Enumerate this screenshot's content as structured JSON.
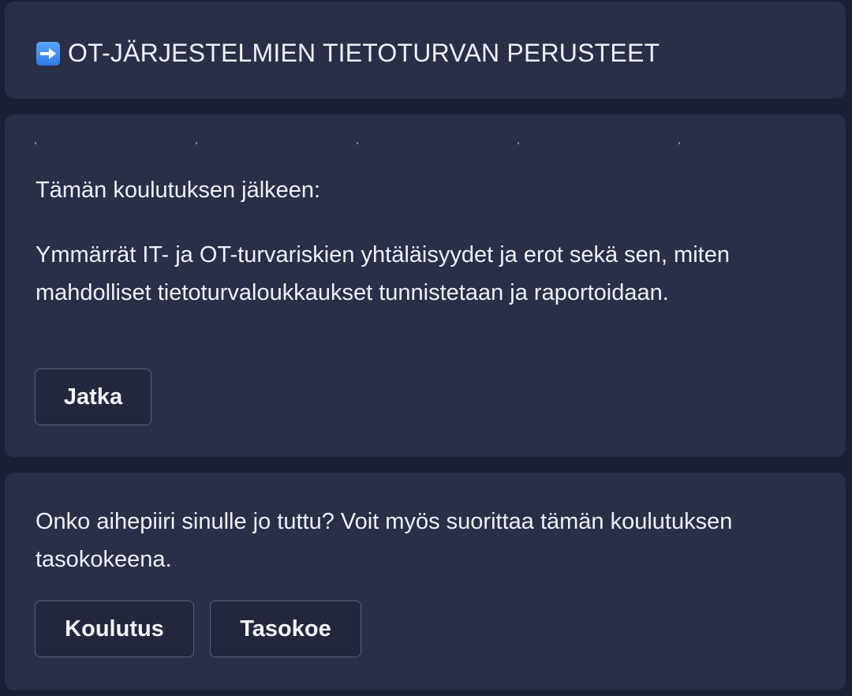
{
  "header": {
    "icon": "right-arrow-icon",
    "title": "OT-JÄRJESTELMIEN TIETOTURVAN PERUSTEET"
  },
  "main": {
    "intro": "Tämän koulutuksen jälkeen:",
    "description": "Ymmärrät IT- ja OT-turvariskien yhtäläisyydet ja erot sekä sen, miten mahdolliset tietoturvaloukkaukset tunnistetaan ja raportoidaan.",
    "continue_label": "Jatka"
  },
  "placement": {
    "prompt": "Onko aihepiiri sinulle jo tuttu? Voit myös suorittaa tämän koulutuksen tasokokeena.",
    "training_label": "Koulutus",
    "test_label": "Tasokoe"
  },
  "colors": {
    "background": "#1c2034",
    "card": "#2a2f48",
    "button": "#22273d",
    "button_border": "#5a6078",
    "text": "#eef0f7",
    "icon_blue": "#3d8ef5"
  }
}
